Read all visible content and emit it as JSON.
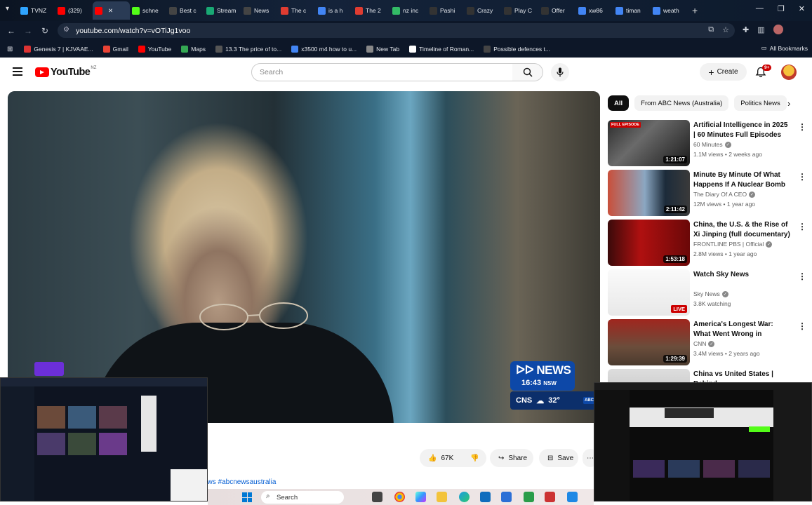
{
  "browser": {
    "tabs": [
      {
        "label": "TVNZ",
        "icon": "tvnz-plus-icon",
        "color": "#2fa4ff"
      },
      {
        "label": "(329)",
        "icon": "youtube-icon",
        "color": "#ff0000"
      },
      {
        "label": "",
        "icon": "youtube-icon",
        "color": "#ff0000",
        "active": true
      },
      {
        "label": "schne",
        "icon": "kick-icon",
        "color": "#53fc18"
      },
      {
        "label": "Best c",
        "icon": "site-icon",
        "color": "#444"
      },
      {
        "label": "Stream",
        "icon": "stream-icon",
        "color": "#19a974"
      },
      {
        "label": "News",
        "icon": "news-icon",
        "color": "#444"
      },
      {
        "label": "The c",
        "icon": "the-icon",
        "color": "#e03c31"
      },
      {
        "label": "is a h",
        "icon": "google-icon",
        "color": "#4285f4"
      },
      {
        "label": "The 2",
        "icon": "the-icon",
        "color": "#e03c31"
      },
      {
        "label": "nz inc",
        "icon": "site-icon",
        "color": "#3b6"
      },
      {
        "label": "Pashi",
        "icon": "site-icon",
        "color": "#333"
      },
      {
        "label": "Crazy",
        "icon": "site-icon",
        "color": "#333"
      },
      {
        "label": "Play C",
        "icon": "site-icon",
        "color": "#333"
      },
      {
        "label": "Offer",
        "icon": "site-icon",
        "color": "#333"
      },
      {
        "label": "xw86",
        "icon": "google-icon",
        "color": "#4285f4"
      },
      {
        "label": "timan",
        "icon": "google-icon",
        "color": "#4285f4"
      },
      {
        "label": "weath",
        "icon": "google-icon",
        "color": "#4285f4"
      }
    ],
    "url": "youtube.com/watch?v=vOTiJg1voo",
    "bookmarks": [
      {
        "label": "Genesis 7 | KJVAAE...",
        "icon": "bookmark-icon",
        "color": "#d33"
      },
      {
        "label": "Gmail",
        "icon": "gmail-icon",
        "color": "#ea4335"
      },
      {
        "label": "YouTube",
        "icon": "youtube-icon",
        "color": "#ff0000"
      },
      {
        "label": "Maps",
        "icon": "maps-icon",
        "color": "#34a853"
      },
      {
        "label": "13.3 The price of to...",
        "icon": "bookmark-icon",
        "color": "#555"
      },
      {
        "label": "x3500 m4 how to u...",
        "icon": "google-icon",
        "color": "#4285f4"
      },
      {
        "label": "New Tab",
        "icon": "newtab-icon",
        "color": "#888"
      },
      {
        "label": "Timeline of Roman...",
        "icon": "wikipedia-icon",
        "color": "#fff"
      },
      {
        "label": "Possible defences t...",
        "icon": "cl-icon",
        "color": "#444"
      }
    ],
    "all_bookmarks": "All Bookmarks"
  },
  "youtube": {
    "logo": "YouTube",
    "region": "NZ",
    "search_placeholder": "Search",
    "create": "Create",
    "notif_badge": "9+"
  },
  "player": {
    "abc_logo": "NEWS",
    "abc_time": "16:43",
    "abc_zone": "NSW",
    "weather_city": "CNS",
    "weather_temp": "32°"
  },
  "actions": {
    "likes": "67K",
    "share": "Share",
    "save": "Save",
    "hashtags": "ews #abcnewsaustralia"
  },
  "chips": [
    "All",
    "From ABC News (Australia)",
    "Politics News"
  ],
  "recommendations": [
    {
      "title": "Artificial Intelligence in 2025 | 60 Minutes Full Episodes",
      "channel": "60 Minutes",
      "verified": true,
      "views": "1.1M views • 2 weeks ago",
      "duration": "1:21:07",
      "badge": "FULL EPISODE",
      "thumb": "linear-gradient(135deg,#2b2b2b,#6a6a6a 40%,#1a1a1a)"
    },
    {
      "title": "Minute By Minute Of What Happens If A Nuclear Bomb ...",
      "channel": "The Diary Of A CEO",
      "verified": true,
      "views": "12M views • 1 year ago",
      "duration": "2:11:42",
      "badge": "",
      "thumb": "linear-gradient(90deg,#c94f3a,#8ba7c2 45%,#1c2b3a 70%,#3a3a3a)"
    },
    {
      "title": "China, the U.S. & the Rise of Xi Jinping (full documentary) | ...",
      "channel": "FRONTLINE PBS | Official",
      "verified": true,
      "views": "2.8M views • 1 year ago",
      "duration": "1:53:18",
      "badge": "",
      "thumb": "linear-gradient(90deg,#3a0a0a,#b01010 40%,#6a0808)"
    },
    {
      "title": "Watch Sky News",
      "channel": "Sky News",
      "verified": true,
      "views": "3.8K watching",
      "duration": "LIVE",
      "badge": "",
      "thumb": "linear-gradient(180deg,#fafafa,#e8e8e8)"
    },
    {
      "title": "America's Longest War: What Went Wrong in Afghanistan ...",
      "channel": "CNN",
      "verified": true,
      "views": "3.4M views • 2 years ago",
      "duration": "1:29:39",
      "badge": "",
      "thumb": "linear-gradient(180deg,#a0261e,#6b4d3b 60%,#4a3a2e)"
    },
    {
      "title": "China vs United States | Behind",
      "channel": "",
      "verified": false,
      "views": "",
      "duration": "",
      "badge": "",
      "thumb": "linear-gradient(180deg,#ddd,#bbb)"
    }
  ],
  "taskbar": {
    "search": "Search"
  }
}
